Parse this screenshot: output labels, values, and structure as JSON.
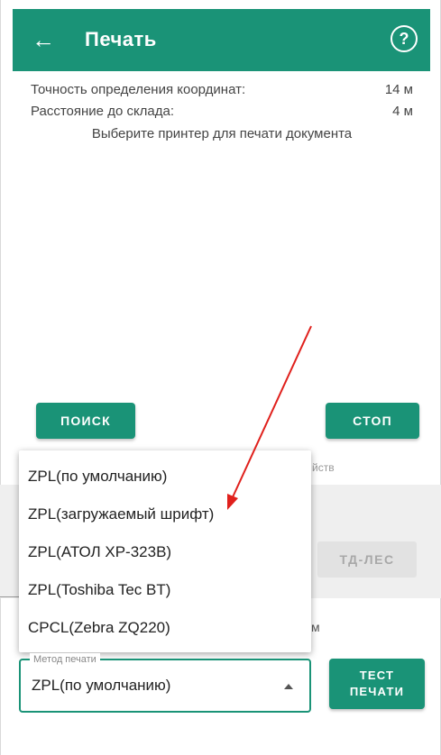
{
  "header": {
    "title": "Печать",
    "back_icon": "arrow-left-icon",
    "help_icon": "question-circle-icon",
    "color": "#1a9377"
  },
  "info": {
    "accuracy_label": "Точность определения координат:",
    "accuracy_value": "14 м",
    "distance_label": "Расстояние до склада:",
    "distance_value": "4 м",
    "select_printer_text": "Выберите принтер для печати документа"
  },
  "buttons": {
    "search": "ПОИСК",
    "stop": "СТОП",
    "td_les": "ТД-ЛЕС",
    "test_line1": "ТЕСТ",
    "test_line2": "ПЕЧАТИ"
  },
  "devices_hint": "йств",
  "stray_char": "м",
  "print_method": {
    "label": "Метод печати",
    "selected": "ZPL(по умолчанию)",
    "options": [
      "ZPL(по умолчанию)",
      "ZPL(загружаемый шрифт)",
      "ZPL(АТОЛ XP-323B)",
      "ZPL(Toshiba Tec BT)",
      "CPCL(Zebra ZQ220)"
    ]
  },
  "annotation": {
    "color": "#e0201c"
  }
}
